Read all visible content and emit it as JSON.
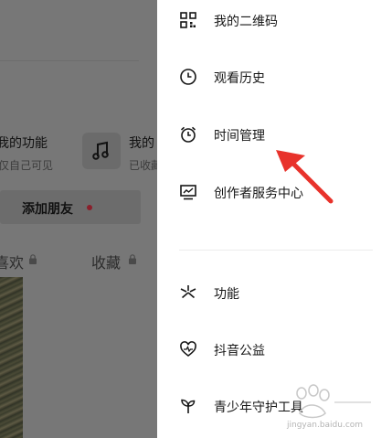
{
  "background": {
    "my_function_title": "我的功能",
    "my_function_sub": "仅自己可见",
    "music_title": "我的",
    "music_sub": "已收藏",
    "add_friend": "添加朋友",
    "tab_like": "喜欢",
    "tab_favorites": "收藏"
  },
  "drawer": {
    "items": [
      {
        "label": "我的二维码",
        "icon": "qr-code-icon"
      },
      {
        "label": "观看历史",
        "icon": "clock-icon"
      },
      {
        "label": "时间管理",
        "icon": "alarm-clock-icon"
      },
      {
        "label": "创作者服务中心",
        "icon": "creator-chart-icon"
      },
      {
        "label": "功能",
        "icon": "sparkle-icon"
      },
      {
        "label": "抖音公益",
        "icon": "heart-pulse-icon"
      },
      {
        "label": "青少年守护工具",
        "icon": "sprout-icon"
      }
    ]
  },
  "annotation": {
    "color": "#e8322b"
  },
  "watermark": {
    "site": "jingyan.baidu.com"
  }
}
